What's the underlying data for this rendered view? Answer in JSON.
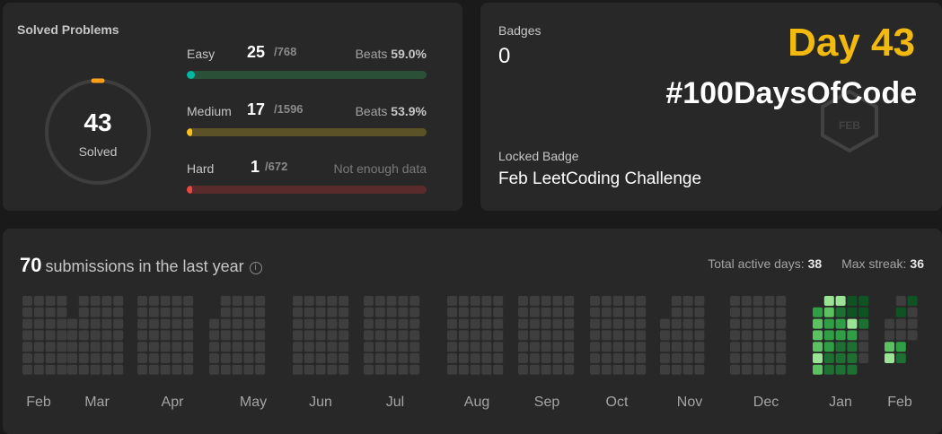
{
  "solved": {
    "title": "Solved Problems",
    "count": "43",
    "label": "Solved",
    "ring_accent": "#ffa116",
    "difficulties": [
      {
        "name": "Easy",
        "solved": "25",
        "total": "/768",
        "beats_label": "Beats",
        "beats_value": "59.0%",
        "fill_fraction": 0.033,
        "fill_color": "#00b8a3",
        "track_color": "#2a5038"
      },
      {
        "name": "Medium",
        "solved": "17",
        "total": "/1596",
        "beats_label": "Beats",
        "beats_value": "53.9%",
        "fill_fraction": 0.011,
        "fill_color": "#ffc01e",
        "track_color": "#5c5227"
      },
      {
        "name": "Hard",
        "solved": "1",
        "total": "/672",
        "note": "Not enough data",
        "fill_fraction": 0.0015,
        "fill_color": "#ef4743",
        "track_color": "#5a2b2b"
      }
    ]
  },
  "badges": {
    "label": "Badges",
    "count": "0",
    "day_title": "Day 43",
    "hashtag": "#100DaysOfCode",
    "badge_icon": "feb-badge-icon",
    "badge_icon_text": "FEB",
    "locked_label": "Locked Badge",
    "locked_name": "Feb LeetCoding Challenge"
  },
  "activity": {
    "count": "70",
    "heading": "submissions in the last year",
    "info_icon": "info-icon",
    "active_days_label": "Total active days:",
    "active_days_value": "38",
    "max_streak_label": "Max streak:",
    "max_streak_value": "36",
    "months": [
      "Feb",
      "Mar",
      "Apr",
      "May",
      "Jun",
      "Jul",
      "Aug",
      "Sep",
      "Oct",
      "Nov",
      "Dec",
      "Jan",
      "Feb"
    ],
    "colors": {
      "empty": "#3e3e3e",
      "l1": "#1e6f32",
      "l2": "#2f9e44",
      "l3": "#5ac261",
      "l4": "#9be495",
      "dark": "#0f5323"
    }
  }
}
